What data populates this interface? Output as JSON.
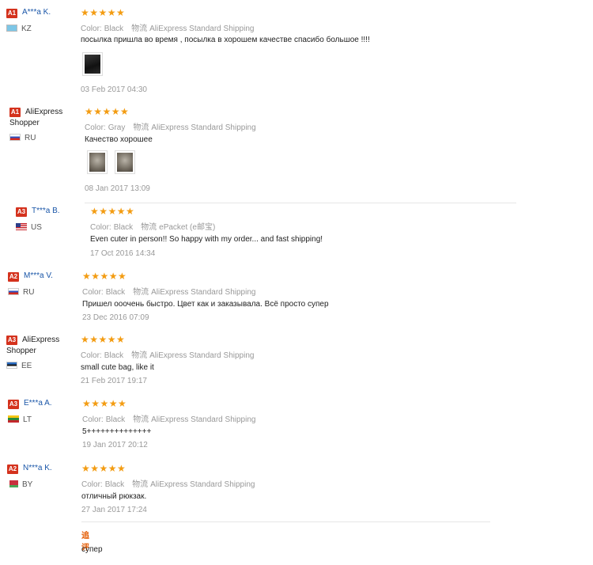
{
  "labels": {
    "color": "Color:",
    "shipping_label": "物流",
    "additional_feedback": "追评"
  },
  "accent_colors": {
    "badge": "#d4321d",
    "stars": "#f39c12",
    "user_link": "#1a56a8",
    "additional": "#e45a00"
  },
  "reviews": [
    {
      "badge": "A1",
      "user": "A***a K.",
      "country": "KZ",
      "stars": "★★★★★",
      "color": "Black",
      "shipping": "AliExpress Standard Shipping",
      "text": "посылка пришла во время , посылка в хорошем качестве спасибо большое !!!!",
      "date": "03 Feb 2017 04:30"
    },
    {
      "badge": "A1",
      "user": "AliExpress Shopper",
      "country": "RU",
      "stars": "★★★★★",
      "color": "Gray",
      "shipping": "AliExpress Standard Shipping",
      "text": "Качество хорошее",
      "date": "08 Jan 2017 13:09"
    },
    {
      "badge": "A3",
      "user": "T***a B.",
      "country": "US",
      "stars": "★★★★★",
      "color": "Black",
      "shipping": "ePacket (e邮宝)",
      "text": "Even cuter in person!! So happy with my order... and fast shipping!",
      "date": "17 Oct 2016 14:34"
    },
    {
      "badge": "A2",
      "user": "M***a V.",
      "country": "RU",
      "stars": "★★★★★",
      "color": "Black",
      "shipping": "AliExpress Standard Shipping",
      "text": "Пришел ооочень быстро. Цвет как и заказывала. Всё просто супер",
      "date": "23 Dec 2016 07:09"
    },
    {
      "badge": "A3",
      "user": "AliExpress Shopper",
      "country": "EE",
      "stars": "★★★★★",
      "color": "Black",
      "shipping": "AliExpress Standard Shipping",
      "text": "small cute bag, like it",
      "date": "21 Feb 2017 19:17"
    },
    {
      "badge": "A3",
      "user": "E***a A.",
      "country": "LT",
      "stars": "★★★★★",
      "color": "Black",
      "shipping": "AliExpress Standard Shipping",
      "text": "5++++++++++++++",
      "date": "19 Jan 2017 20:12"
    },
    {
      "badge": "A2",
      "user": "N***a K.",
      "country": "BY",
      "stars": "★★★★★",
      "color": "Black",
      "shipping": "AliExpress Standard Shipping",
      "text": "отличный рюкзак.",
      "date": "27 Jan 2017 17:24",
      "followup": "супер"
    }
  ]
}
